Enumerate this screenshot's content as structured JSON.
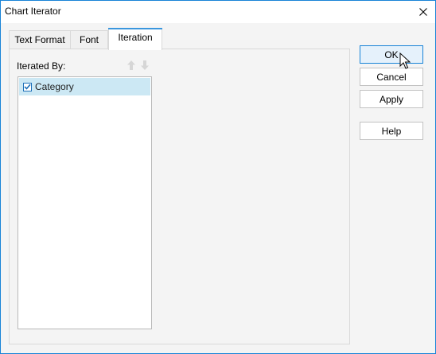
{
  "window": {
    "title": "Chart Iterator"
  },
  "tabs": [
    {
      "label": "Text Format",
      "active": false
    },
    {
      "label": "Font",
      "active": false
    },
    {
      "label": "Iteration",
      "active": true
    }
  ],
  "iteration": {
    "label": "Iterated By:",
    "items": [
      {
        "label": "Category",
        "checked": true,
        "selected": true
      }
    ]
  },
  "buttons": {
    "ok": "OK",
    "cancel": "Cancel",
    "apply": "Apply",
    "help": "Help"
  },
  "colors": {
    "accent": "#1883d7",
    "selection": "#cce8f4"
  },
  "icons": {
    "close": "close-icon",
    "move_up": "arrow-up-icon",
    "move_down": "arrow-down-icon",
    "check": "checkmark-icon",
    "cursor": "mouse-pointer-icon"
  }
}
